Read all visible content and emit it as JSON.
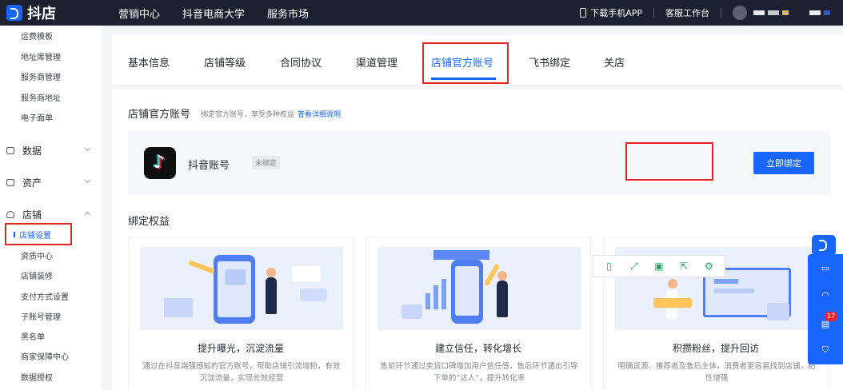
{
  "topbar": {
    "logo_text": "抖店",
    "nav": [
      "营销中心",
      "抖音电商大学",
      "服务市场"
    ],
    "download_app": "下载手机APP",
    "service_desk": "客服工作台"
  },
  "sidebar": {
    "items_top": [
      "运费模板",
      "地址库管理",
      "服务商管理",
      "服务商地址",
      "电子面单"
    ],
    "group_data": "数据",
    "group_assets": "资产",
    "group_shop": "店铺",
    "active_item": "店铺设置",
    "items_shop": [
      "资质中心",
      "店铺装修",
      "支付方式设置",
      "子账号管理",
      "黑名单",
      "商家保障中心",
      "数据授权"
    ]
  },
  "tabs": {
    "items": [
      "基本信息",
      "店铺等级",
      "合同协议",
      "渠道管理",
      "店铺官方账号",
      "飞书绑定",
      "关店"
    ],
    "active_index": 4
  },
  "official_account": {
    "title": "店铺官方账号",
    "desc": "绑定官方账号，享受多种权益",
    "detail_link": "查看详细说明",
    "account_name": "抖音账号",
    "status_badge": "未绑定",
    "bind_button": "立即绑定"
  },
  "benefits": {
    "title": "绑定权益",
    "cards": [
      {
        "title": "提升曝光，沉淀流量",
        "desc": "通过在抖音端强感知的官方账号，帮助店铺引流增粉，有效沉淀流量，实现长效经营"
      },
      {
        "title": "建立信任，转化增长",
        "desc": "售前环节通过卖货口碑增加用户信任感，售后环节透出引导下单的“达人”，提升转化率"
      },
      {
        "title": "积攒粉丝，提升回访",
        "desc": "明确货源、推荐者及售后主体，消费者更容易找到店铺，粘性增强"
      }
    ]
  },
  "float_panel": {
    "badge_count": "17"
  },
  "colors": {
    "primary": "#1966ff",
    "topbar_bg": "#1c2130",
    "highlight_red": "#e0242a"
  }
}
